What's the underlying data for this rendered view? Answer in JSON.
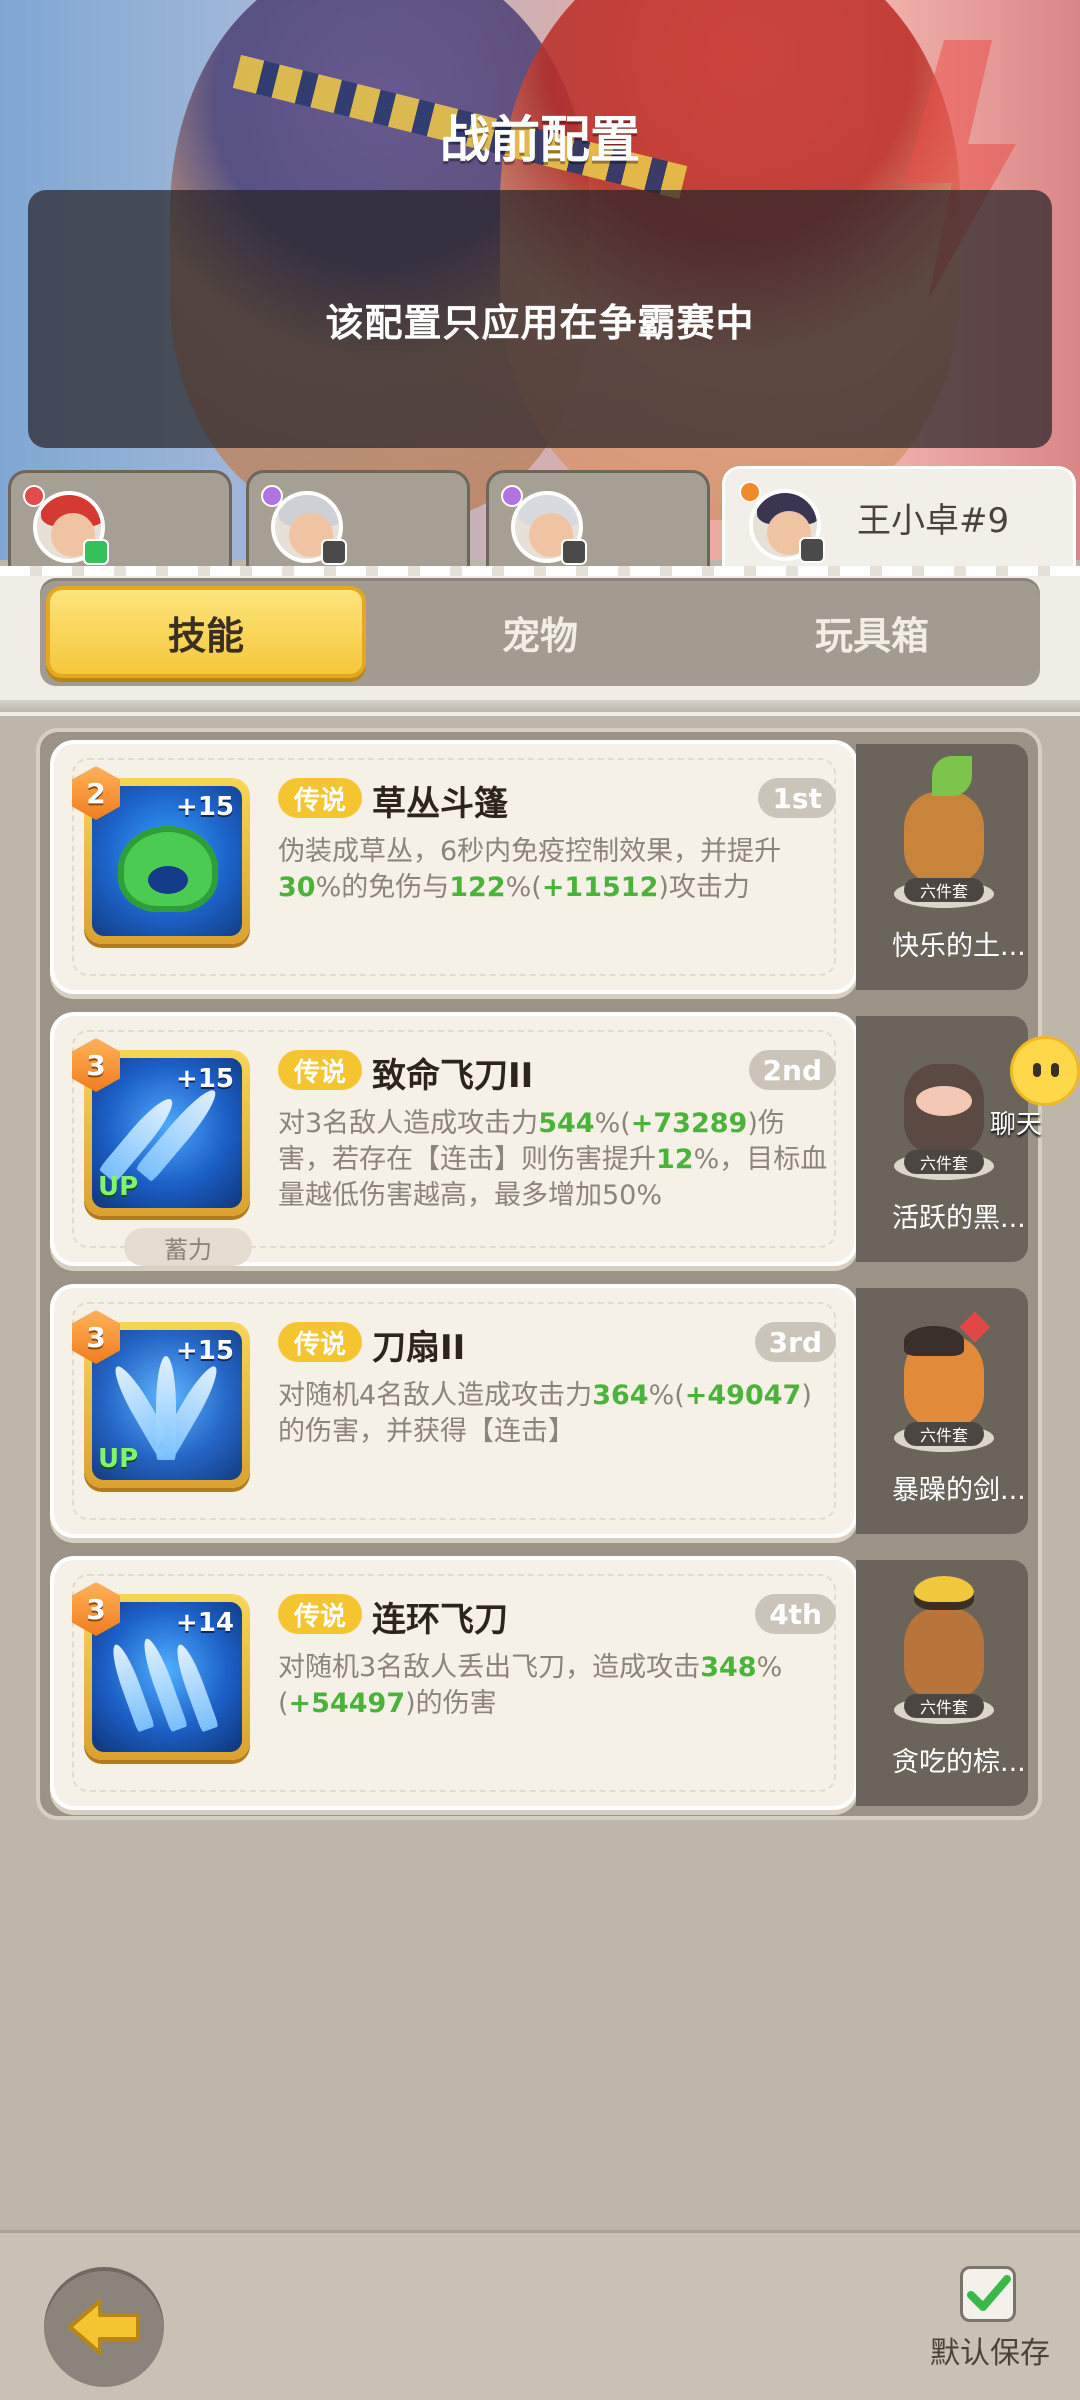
{
  "header": {
    "title": "战前配置",
    "notice": "该配置只应用在争霸赛中"
  },
  "hero_tabs": [
    {
      "name": "",
      "selected": false
    },
    {
      "name": "",
      "selected": false
    },
    {
      "name": "",
      "selected": false
    },
    {
      "name": "王小卓#9",
      "selected": true
    }
  ],
  "tabs": [
    {
      "label": "技能",
      "selected": true
    },
    {
      "label": "宠物",
      "selected": false
    },
    {
      "label": "玩具箱",
      "selected": false
    }
  ],
  "skills": [
    {
      "level": "2",
      "plus": "+15",
      "badge": "传说",
      "name": "草丛斗篷",
      "rank": "1st",
      "desc_parts": [
        "伪装成草丛，6秒内免疫控制效果，并提升",
        "30",
        "%的免伤与",
        "122",
        "%(",
        "+11512",
        ")攻击力"
      ],
      "up": false,
      "charge": ""
    },
    {
      "level": "3",
      "plus": "+15",
      "badge": "传说",
      "name": "致命飞刀II",
      "rank": "2nd",
      "desc_parts": [
        "对3名敌人造成攻击力",
        "544",
        "%(",
        "+73289",
        ")伤害，若存在【连击】则伤害提升",
        "12",
        "%，目标血量越低伤害越高，最多增加50%"
      ],
      "up": true,
      "charge": "蓄力"
    },
    {
      "level": "3",
      "plus": "+15",
      "badge": "传说",
      "name": "刀扇II",
      "rank": "3rd",
      "desc_parts": [
        "对随机4名敌人造成攻击力",
        "364",
        "%(",
        "+49047",
        ")的伤害，并获得【连击】"
      ],
      "up": true,
      "charge": ""
    },
    {
      "level": "3",
      "plus": "+14",
      "badge": "传说",
      "name": "连环飞刀",
      "rank": "4th",
      "desc_parts": [
        "对随机3名敌人丢出飞刀，造成攻击",
        "348",
        "%(",
        "+54497",
        ")的伤害"
      ],
      "up": false,
      "charge": ""
    }
  ],
  "pets": [
    {
      "name": "快乐的土...",
      "set": "六件套",
      "color": "#c9843b"
    },
    {
      "name": "活跃的黑...",
      "set": "六件套",
      "color": "#5b4a42"
    },
    {
      "name": "暴躁的剑...",
      "set": "六件套",
      "color": "#e08a3a"
    },
    {
      "name": "贪吃的棕...",
      "set": "六件套",
      "color": "#b8743b"
    }
  ],
  "chat": {
    "label": "聊天"
  },
  "footer": {
    "save_label": "默认保存"
  },
  "colors": {
    "accent": "#f5c531",
    "green": "#4bb33c",
    "tab_active": "#f7d45a"
  }
}
